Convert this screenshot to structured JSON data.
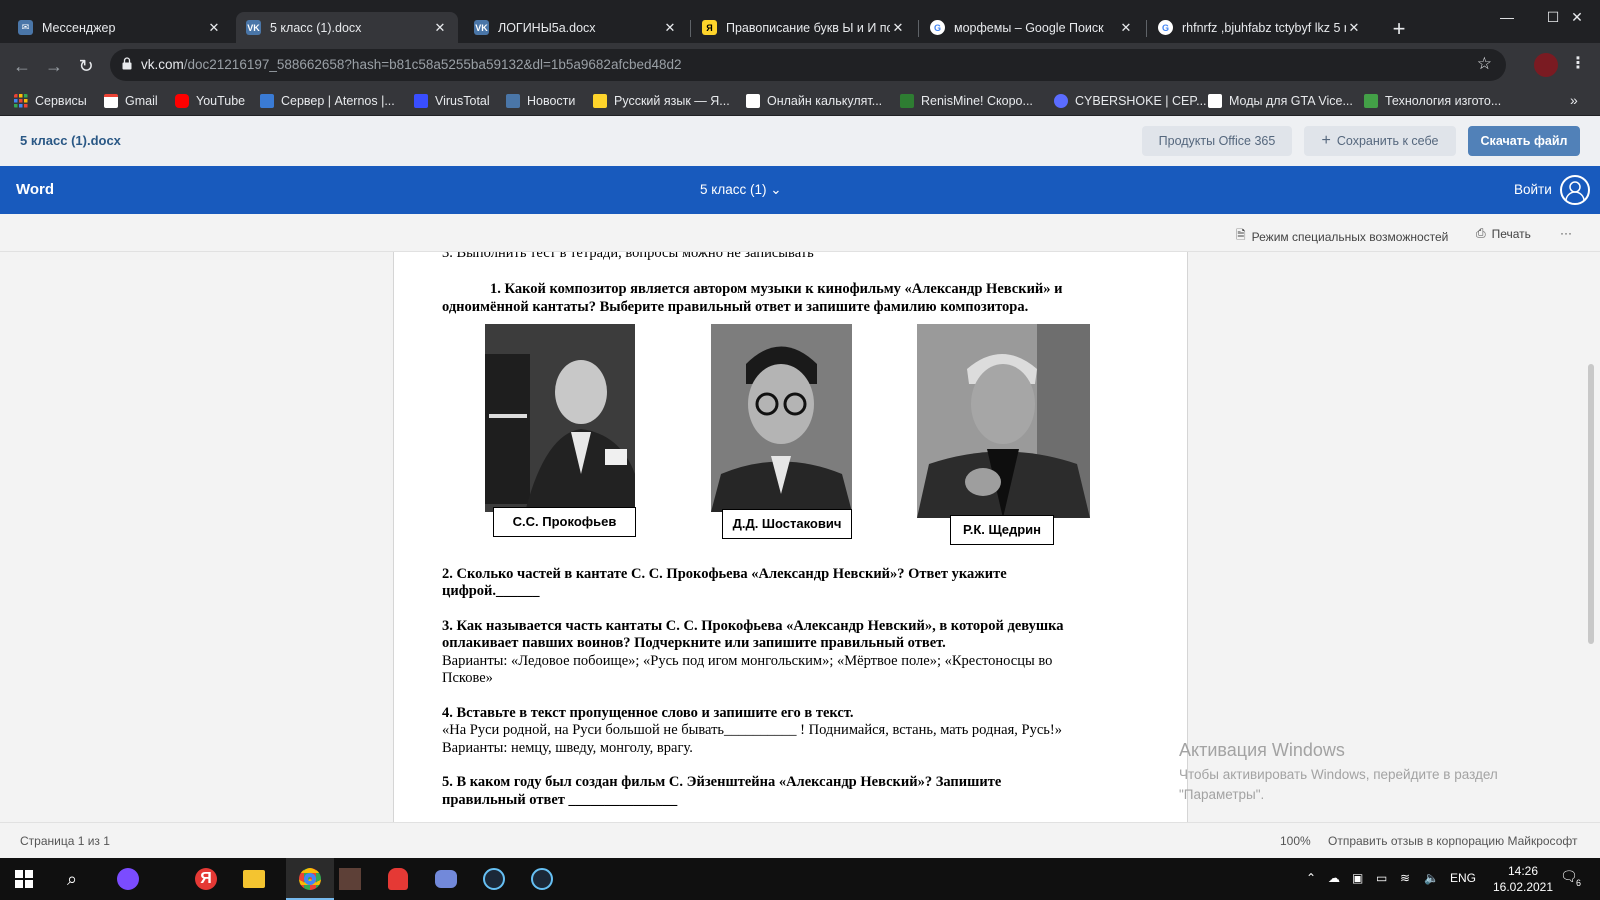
{
  "browser": {
    "tabs": [
      {
        "title": "Мессенджер",
        "icon": "vk-messenger-icon",
        "color": "#4a76a8",
        "active": false
      },
      {
        "title": "5 класс (1).docx",
        "icon": "vk-icon",
        "color": "#4a76a8",
        "active": true
      },
      {
        "title": "ЛОГИНЫ5a.docx",
        "icon": "vk-icon",
        "color": "#4a76a8",
        "active": false
      },
      {
        "title": "Правописание букв Ы и И по",
        "icon": "yandex-zen-icon",
        "color": "#fed42b",
        "active": false
      },
      {
        "title": "морфемы – Google Поиск",
        "icon": "google-icon",
        "color": "#ffffff",
        "active": false
      },
      {
        "title": "rhfnrfz ,bjuhfabz tctybyf lkz 5 r",
        "icon": "google-icon",
        "color": "#ffffff",
        "active": false
      }
    ],
    "new_tab": "+",
    "url_host": "vk.com",
    "url_path": "/doc21216197_588662658?hash=b81c58a5255ba59132&dl=1b5a9682afcbed48d2",
    "bookmarks": [
      {
        "label": "Сервисы",
        "icon": "apps-grid-icon",
        "color": "#e8453c"
      },
      {
        "label": "Gmail",
        "icon": "gmail-icon",
        "color": "#ea4335"
      },
      {
        "label": "YouTube",
        "icon": "youtube-icon",
        "color": "#ff0000"
      },
      {
        "label": "Сервер | Aternos |...",
        "icon": "aternos-icon",
        "color": "#3a7bd5"
      },
      {
        "label": "VirusTotal",
        "icon": "virustotal-icon",
        "color": "#394eff"
      },
      {
        "label": "Новости",
        "icon": "vk-icon",
        "color": "#4a76a8"
      },
      {
        "label": "Русский язык — Я...",
        "icon": "yandex-icon",
        "color": "#fed42b"
      },
      {
        "label": "Онлайн калькулят...",
        "icon": "calculator-icon",
        "color": "#ffffff"
      },
      {
        "label": "RenisMine! Скоро...",
        "icon": "creeper-icon",
        "color": "#2e7d32"
      },
      {
        "label": "CYBERSHOKE | CEP...",
        "icon": "cybershoke-icon",
        "color": "#5b6cff"
      },
      {
        "label": "Моды для GTA Vice...",
        "icon": "gta-icon",
        "color": "#ffffff"
      },
      {
        "label": "Технология изгото...",
        "icon": "leaf-icon",
        "color": "#43a047"
      }
    ]
  },
  "vk": {
    "doc_name": "5 класс (1).docx",
    "office_label": "Продукты Office 365",
    "save_label": "Сохранить к себе",
    "download_label": "Скачать файл"
  },
  "word": {
    "brand": "Word",
    "doc_title": "5 класс (1)",
    "login": "Войти",
    "accessibility": "Режим специальных возможностей",
    "print": "Печать",
    "more": "···"
  },
  "doc": {
    "task_line": "3. Выполнить тест в тетради, вопросы можно не записывать",
    "q1_line1": "1. Какой композитор является автором музыки к кинофильму «Александр Невский» и",
    "q1_line2": "одноимённой кантаты? Выберите правильный ответ и запишите фамилию композитора.",
    "captions": [
      "С.С. Прокофьев",
      "Д.Д. Шостакович",
      "Р.К. Щедрин"
    ],
    "q2_line1": "2. Сколько частей в кантате С. С. Прокофьева «Александр Невский»? Ответ укажите",
    "q2_line2": "цифрой.______",
    "q3_line1": "3. Как называется часть кантаты С. С. Прокофьева «Александр Невский», в которой девушка",
    "q3_line2": "оплакивает павших воинов? Подчеркните или запишите правильный ответ.",
    "q3_opts1": "Варианты: «Ледовое побоище»; «Русь под игом монгольским»; «Мёртвое поле»; «Крестоносцы во",
    "q3_opts2": "Пскове»",
    "q4_line1": "4. Вставьте в текст пропущенное слово и запишите его в текст.",
    "q4_line2": "«На Руси родной, на Руси большой не бывать__________ ! Поднимайся, встань, мать родная, Русь!»",
    "q4_opts": "Варианты: немцу, шведу, монголу, врагу.",
    "q5_line1": "5. В каком году был создан фильм С. Эйзенштейна «Александр Невский»? Запишите",
    "q5_line2": "правильный ответ _______________"
  },
  "watermark": {
    "title": "Активация Windows",
    "text": "Чтобы активировать Windows, перейдите в раздел \"Параметры\"."
  },
  "status": {
    "page": "Страница 1 из 1",
    "zoom": "100%",
    "feedback": "Отправить отзыв в корпорацию Майкрософт"
  },
  "taskbar": {
    "lang": "ENG",
    "time": "14:26",
    "date": "16.02.2021",
    "notifications": "6"
  }
}
